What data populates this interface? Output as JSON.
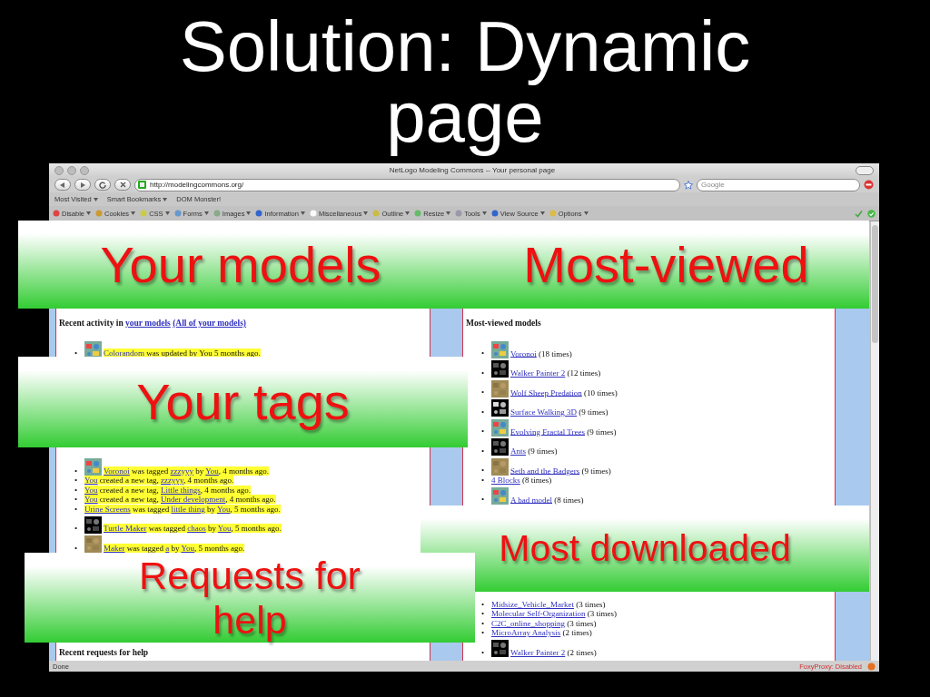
{
  "slide": {
    "title": "Solution: Dynamic page"
  },
  "browser": {
    "title": "NetLogo Modeling Commons -- Your personal page",
    "url": "http://modelingcommons.org/",
    "search": {
      "placeholder": "Google"
    },
    "bookmarks": [
      {
        "label": "Most Visited",
        "menu": true
      },
      {
        "label": "Smart Bookmarks",
        "menu": true
      },
      {
        "label": "DOM Monster!",
        "menu": false
      }
    ],
    "dev_toolbar": [
      {
        "label": "Disable"
      },
      {
        "label": "Cookies"
      },
      {
        "label": "CSS"
      },
      {
        "label": "Forms"
      },
      {
        "label": "Images"
      },
      {
        "label": "Information"
      },
      {
        "label": "Miscellaneous"
      },
      {
        "label": "Outline"
      },
      {
        "label": "Resize"
      },
      {
        "label": "Tools"
      },
      {
        "label": "View Source"
      },
      {
        "label": "Options"
      }
    ],
    "status": "Done",
    "proxy": "FoxyProxy: Disabled"
  },
  "recent_activity": {
    "heading": [
      {
        "text": "Recent activity in "
      },
      {
        "link": "your models"
      },
      {
        "link": "(All of your models)"
      }
    ],
    "items": [
      {
        "bullet": "•",
        "kind": "thumbnail",
        "parts": [
          {
            "link": "Colorandom"
          },
          {
            "text": " was updated by You 5 months ago."
          }
        ]
      }
    ]
  },
  "recent_tags": {
    "items": [
      {
        "bullet": "•",
        "kind": "thumbnail",
        "parts": [
          {
            "link": "Voronoi"
          },
          {
            "text": " was tagged "
          },
          {
            "link": "zzzyyy"
          },
          {
            "text": " by "
          },
          {
            "link": "You"
          },
          {
            "text": ", 4 months ago."
          }
        ]
      },
      {
        "bullet": "•",
        "kind": "text",
        "parts": [
          {
            "link": "You"
          },
          {
            "text": " created a new tag, "
          },
          {
            "link": "zzzyyy"
          },
          {
            "text": ", 4 months ago."
          }
        ]
      },
      {
        "bullet": "•",
        "kind": "text",
        "parts": [
          {
            "link": "You"
          },
          {
            "text": " created a new tag, "
          },
          {
            "link": "Little things"
          },
          {
            "text": ", 4 months ago."
          }
        ]
      },
      {
        "bullet": "•",
        "kind": "text",
        "parts": [
          {
            "link": "You"
          },
          {
            "text": " created a new tag, "
          },
          {
            "link": "Under development"
          },
          {
            "text": ", 4 months ago."
          }
        ]
      },
      {
        "bullet": "•",
        "kind": "text",
        "parts": [
          {
            "link": "Urine Screens"
          },
          {
            "text": " was tagged "
          },
          {
            "link": "little thing"
          },
          {
            "text": " by "
          },
          {
            "link": "You"
          },
          {
            "text": ", 5 months ago."
          }
        ]
      },
      {
        "bullet": "•",
        "kind": "thumbnail",
        "parts": [
          {
            "link": "Turtle Maker"
          },
          {
            "text": " was tagged "
          },
          {
            "link": "chaos"
          },
          {
            "text": " by "
          },
          {
            "link": "You"
          },
          {
            "text": ", 5 months ago."
          }
        ]
      },
      {
        "bullet": "•",
        "kind": "thumbnail",
        "parts": [
          {
            "link": "Maker"
          },
          {
            "text": " was tagged "
          },
          {
            "link": "a"
          },
          {
            "text": " by "
          },
          {
            "link": "You"
          },
          {
            "text": ", 5 months ago."
          }
        ]
      }
    ]
  },
  "requests_heading": "Recent requests for help",
  "most_viewed": {
    "heading": "Most-viewed models",
    "items": [
      {
        "bullet": "•",
        "kind": "thumbnail",
        "name": "Voronoi",
        "count": "(18 times)"
      },
      {
        "bullet": "•",
        "kind": "thumbnail",
        "name": "Walker Painter 2",
        "count": "(12 times)"
      },
      {
        "bullet": "•",
        "kind": "thumbnail",
        "name": "Wolf Sheep Predation",
        "count": "(10 times)"
      },
      {
        "bullet": "•",
        "kind": "thumbnail",
        "name": "Surface Walking 3D",
        "count": "(9 times)"
      },
      {
        "bullet": "•",
        "kind": "thumbnail",
        "name": "Evolving Fractal Trees",
        "count": "(9 times)"
      },
      {
        "bullet": "•",
        "kind": "thumbnail",
        "name": "Ants",
        "count": "(9 times)"
      },
      {
        "bullet": "•",
        "kind": "thumbnail",
        "name": "Seth and the Badgers",
        "count": "(9 times)"
      },
      {
        "bullet": "•",
        "kind": "text",
        "name": "4 Blocks",
        "count": "(8 times)"
      },
      {
        "bullet": "•",
        "kind": "thumbnail",
        "name": "A bad model",
        "count": "(8 times)"
      }
    ]
  },
  "most_downloaded": {
    "items": [
      {
        "bullet": "•",
        "kind": "text",
        "name": "Midsize_Vehicle_Market",
        "count": "(3 times)"
      },
      {
        "bullet": "•",
        "kind": "text",
        "name": "Molecular Self-Organization",
        "count": "(3 times)"
      },
      {
        "bullet": "•",
        "kind": "text",
        "name": "C2C_online_shopping",
        "count": "(3 times)"
      },
      {
        "bullet": "•",
        "kind": "text",
        "name": "MicroArray Analysis",
        "count": "(2 times)"
      },
      {
        "bullet": "•",
        "kind": "thumbnail",
        "name": "Walker Painter 2",
        "count": "(2 times)"
      }
    ]
  },
  "callouts": [
    {
      "text": "Your models"
    },
    {
      "text": "Most-viewed"
    },
    {
      "text": "Your tags"
    },
    {
      "text": "Most downloaded"
    },
    {
      "text": "Requests for help"
    }
  ]
}
